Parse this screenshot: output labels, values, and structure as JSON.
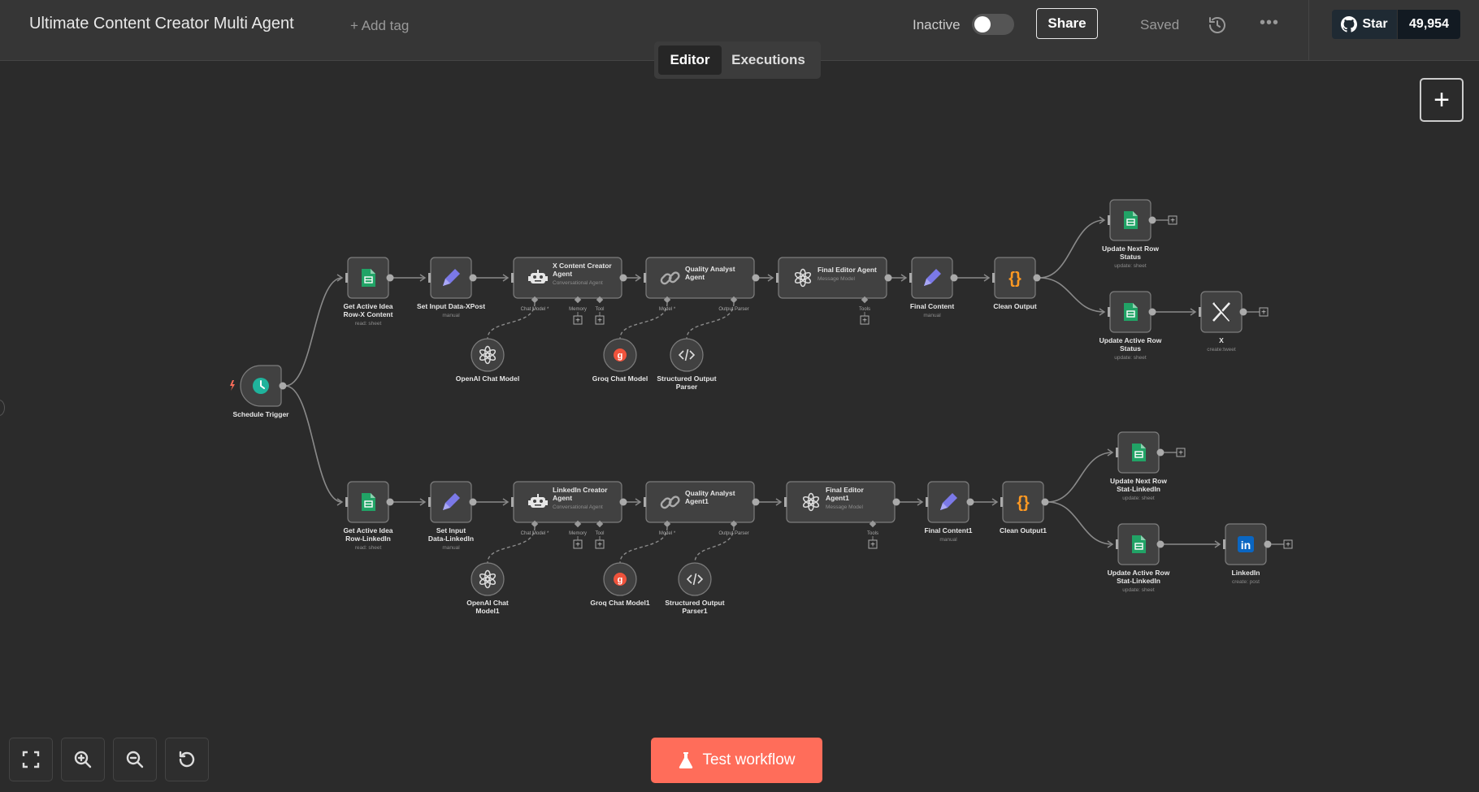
{
  "header": {
    "workflow_name": "Ultimate Content Creator Multi Agent",
    "add_tag": "+ Add tag",
    "status_label": "Inactive",
    "share_label": "Share",
    "saved_label": "Saved",
    "more_label": "•••",
    "github_star_label": "Star",
    "github_star_count": "49,954"
  },
  "tabs": [
    {
      "label": "Editor",
      "active": true
    },
    {
      "label": "Executions",
      "active": false
    }
  ],
  "footer": {
    "test_workflow_label": "Test workflow",
    "zoom_controls": [
      "fit-view-icon",
      "zoom-in-icon",
      "zoom-out-icon",
      "reset-zoom-icon"
    ]
  },
  "colors": {
    "accent": "#ff6d5a",
    "sheet_green": "#21a366",
    "set_purple": "#7b79e8",
    "code_orange": "#ff9922",
    "trigger_teal": "#1fb39c",
    "groq_red": "#f0533c",
    "linkedin_blue": "#0a66c2"
  },
  "workflow": {
    "trigger": {
      "name": "Schedule Trigger",
      "icon": "clock-icon"
    },
    "nodes": [
      {
        "id": "getx",
        "name": "Get Active Idea Row-X Content",
        "sub": "read: sheet",
        "icon": "sheet-icon"
      },
      {
        "id": "setx",
        "name": "Set Input Data-XPost",
        "sub": "manual",
        "icon": "pencil-icon"
      },
      {
        "id": "xagent",
        "name": "X Content Creator Agent",
        "sub": "Conversational Agent",
        "icon": "robot-icon"
      },
      {
        "id": "qa",
        "name": "Quality Analyst Agent",
        "sub": "",
        "icon": "chain-icon"
      },
      {
        "id": "fe",
        "name": "Final Editor Agent",
        "sub": "Message Model",
        "icon": "openai-icon"
      },
      {
        "id": "fc",
        "name": "Final Content",
        "sub": "manual",
        "icon": "pencil-icon"
      },
      {
        "id": "co",
        "name": "Clean Output",
        "sub": "",
        "icon": "braces-icon"
      },
      {
        "id": "unr",
        "name": "Update Next Row Status",
        "sub": "update: sheet",
        "icon": "sheet-icon"
      },
      {
        "id": "uar",
        "name": "Update Active Row Status",
        "sub": "update: sheet",
        "icon": "sheet-icon"
      },
      {
        "id": "x",
        "name": "X",
        "sub": "create:tweet",
        "icon": "x-logo-icon"
      },
      {
        "id": "getl",
        "name": "Get Active Idea Row-LinkedIn",
        "sub": "read: sheet",
        "icon": "sheet-icon"
      },
      {
        "id": "setl",
        "name": "Set Input Data-LinkedIn",
        "sub": "manual",
        "icon": "pencil-icon"
      },
      {
        "id": "lagent",
        "name": "LinkedIn Creator Agent",
        "sub": "Conversational Agent",
        "icon": "robot-icon"
      },
      {
        "id": "qa1",
        "name": "Quality Analyst Agent1",
        "sub": "",
        "icon": "chain-icon"
      },
      {
        "id": "fe1",
        "name": "Final Editor Agent1",
        "sub": "Message Model",
        "icon": "openai-icon"
      },
      {
        "id": "fc1",
        "name": "Final Content1",
        "sub": "manual",
        "icon": "pencil-icon"
      },
      {
        "id": "co1",
        "name": "Clean Output1",
        "sub": "",
        "icon": "braces-icon"
      },
      {
        "id": "unr1",
        "name": "Update Next Row Stat-LinkedIn",
        "sub": "update: sheet",
        "icon": "sheet-icon"
      },
      {
        "id": "uar1",
        "name": "Update Active Row Stat-LinkedIn",
        "sub": "update: sheet",
        "icon": "sheet-icon"
      },
      {
        "id": "li",
        "name": "LinkedIn",
        "sub": "create: post",
        "icon": "linkedin-icon"
      }
    ],
    "sub_nodes": [
      {
        "id": "oai",
        "name": "OpenAI Chat Model",
        "icon": "openai-icon"
      },
      {
        "id": "groq",
        "name": "Groq Chat Model",
        "icon": "groq-icon"
      },
      {
        "id": "sop",
        "name": "Structured Output Parser",
        "icon": "code-icon"
      },
      {
        "id": "oai1",
        "name": "OpenAI Chat Model1",
        "icon": "openai-icon"
      },
      {
        "id": "groq1",
        "name": "Groq Chat Model1",
        "icon": "groq-icon"
      },
      {
        "id": "sop1",
        "name": "Structured Output Parser1",
        "icon": "code-icon"
      }
    ],
    "port_labels": {
      "chat_model": "Chat Model",
      "memory": "Memory",
      "tool": "Tool",
      "model": "Model",
      "output_parser": "Output Parser",
      "tools": "Tools",
      "required_mark": "*"
    }
  }
}
